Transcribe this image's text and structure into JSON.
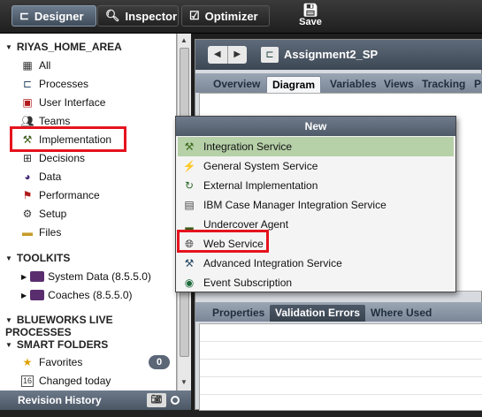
{
  "toolbar": {
    "designer": "Designer",
    "inspector": "Inspector",
    "optimizer": "Optimizer",
    "save": "Save"
  },
  "nav": {
    "area": "RIYAS_HOME_AREA",
    "items": [
      {
        "label": "All",
        "icon": "grid-icon"
      },
      {
        "label": "Processes",
        "icon": "process-icon"
      },
      {
        "label": "User Interface",
        "icon": "user-interface-icon"
      },
      {
        "label": "Teams",
        "icon": "teams-icon"
      },
      {
        "label": "Implementation",
        "icon": "implementation-icon"
      },
      {
        "label": "Decisions",
        "icon": "decisions-icon"
      },
      {
        "label": "Data",
        "icon": "data-icon"
      },
      {
        "label": "Performance",
        "icon": "flag-icon"
      },
      {
        "label": "Setup",
        "icon": "gear-icon"
      },
      {
        "label": "Files",
        "icon": "folder-icon"
      }
    ],
    "toolkits_header": "TOOLKITS",
    "toolkits": [
      {
        "label": "System Data (8.5.5.0)"
      },
      {
        "label": "Coaches (8.5.5.0)"
      }
    ],
    "blueworks_header": "BLUEWORKS LIVE PROCESSES",
    "smart_header": "SMART FOLDERS",
    "smart": [
      {
        "label": "Favorites",
        "badge": "0"
      },
      {
        "label": "Changed today"
      }
    ],
    "revision_history": "Revision History"
  },
  "editor": {
    "title": "Assignment2_SP",
    "tabs": [
      "Overview",
      "Diagram",
      "Variables",
      "Views",
      "Tracking",
      "Pr"
    ],
    "active_tab": "Diagram",
    "bottom_tabs": [
      "Properties",
      "Validation Errors",
      "Where Used"
    ],
    "active_bottom_tab": "Validation Errors"
  },
  "popup": {
    "header": "New",
    "items": [
      {
        "label": "Integration Service",
        "icon": "integration-service-icon"
      },
      {
        "label": "General System Service",
        "icon": "system-service-icon"
      },
      {
        "label": "External Implementation",
        "icon": "external-implementation-icon"
      },
      {
        "label": "IBM Case Manager Integration Service",
        "icon": "case-manager-icon"
      },
      {
        "label": "Undercover Agent",
        "icon": "undercover-agent-icon"
      },
      {
        "label": "Web Service",
        "icon": "globe-icon"
      },
      {
        "label": "Advanced Integration Service",
        "icon": "advanced-integration-icon"
      },
      {
        "label": "Event Subscription",
        "icon": "event-subscription-icon"
      }
    ],
    "highlighted": "Integration Service"
  },
  "colors": {
    "highlight_box": "#e5131d",
    "menu_hover": "#b6d0a8"
  }
}
